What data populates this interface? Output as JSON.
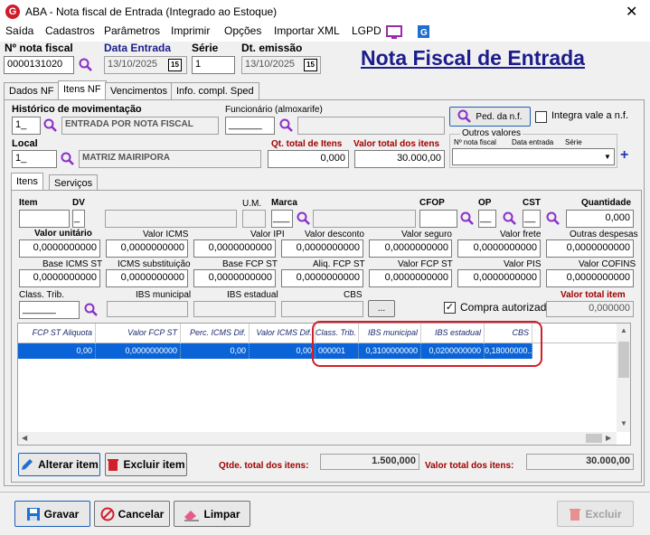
{
  "window": {
    "title": "ABA - Nota fiscal de Entrada (Integrado ao Estoque)",
    "app_icon": "G",
    "close": "✕"
  },
  "menu": [
    "Saída",
    "Cadastros",
    "Parâmetros",
    "Imprimir",
    "Opções",
    "Importar XML",
    "LGPD"
  ],
  "header": {
    "nota_label": "Nº nota fiscal",
    "nota_value": "0000131020",
    "data_entrada_label": "Data Entrada",
    "data_entrada_value": "13/10/2025",
    "serie_label": "Série",
    "serie_value": "1",
    "dt_emissao_label": "Dt. emissão",
    "dt_emissao_value": "13/10/2025",
    "cal_icon": "15",
    "big_title": "Nota Fiscal de Entrada"
  },
  "tabs": [
    "Dados NF",
    "Itens NF",
    "Vencimentos",
    "Info. compl. Sped"
  ],
  "itens_nf": {
    "historico_label": "Histórico de movimentação",
    "historico_code": "1_",
    "historico_desc": "ENTRADA POR NOTA FISCAL",
    "funcionario_label": "Funcionário (almoxarife)",
    "funcionario_value": "______",
    "ped_button": "Ped. da n.f.",
    "integra_label": "Integra vale a n.f.",
    "local_label": "Local",
    "local_code": "1_",
    "local_desc": "MATRIZ MAIRIPORA",
    "qt_total_label": "Qt. total de Itens",
    "qt_total_value": "0,000",
    "valor_total_label": "Valor total dos itens",
    "valor_total_value": "30.000,00",
    "outros_title": "Outros valores",
    "outros_col1": "Nº nota fiscal",
    "outros_col2": "Data entrada",
    "outros_col3": "Série",
    "plus": "+"
  },
  "subtabs": [
    "Itens",
    "Serviços"
  ],
  "item_form": {
    "item_label": "Item",
    "dv_label": "DV",
    "dv_value": "_",
    "um_label": "U.M.",
    "marca_label": "Marca",
    "marca_value": "___",
    "cfop_label": "CFOP",
    "op_label": "OP",
    "op_value": "__",
    "cst_label": "CST",
    "cst_value": "__",
    "quantidade_label": "Quantidade",
    "quantidade_value": "0,000",
    "row2_labels": [
      "Valor unitário",
      "Valor ICMS",
      "Valor IPI",
      "Valor desconto",
      "Valor seguro",
      "Valor frete",
      "Outras despesas"
    ],
    "row2_values": [
      "0,0000000000",
      "0,0000000000",
      "0,0000000000",
      "0,0000000000",
      "0,0000000000",
      "0,0000000000",
      "0,0000000000"
    ],
    "row3_labels": [
      "Base ICMS ST",
      "ICMS substituição",
      "Base FCP ST",
      "Aliq. FCP ST",
      "Valor FCP ST",
      "Valor PIS",
      "Valor COFINS"
    ],
    "row3_values": [
      "0,0000000000",
      "0,0000000000",
      "0,0000000000",
      "0,0000000000",
      "0,0000000000",
      "0,0000000000",
      "0,0000000000"
    ],
    "class_trib_label": "Class. Trib.",
    "class_trib_value": "______",
    "ibs_mun_label": "IBS municipal",
    "ibs_est_label": "IBS estadual",
    "cbs_label": "CBS",
    "ellipsis": "...",
    "compra_label": "Compra autorizada",
    "valor_total_item_label": "Valor total item",
    "valor_total_item_value": "0,000000"
  },
  "grid": {
    "headers": [
      "FCP ST Aliquota",
      "Valor FCP ST",
      "Perc. ICMS Dif.",
      "Valor ICMS Dif.",
      "Class. Trib.",
      "IBS municipal",
      "IBS estadual",
      "CBS"
    ],
    "row": [
      "0,00",
      "0,0000000000",
      "0,00",
      "0,00",
      "000001",
      "0,3100000000",
      "0,0200000000",
      "0,18000000..."
    ]
  },
  "footer": {
    "alterar": "Alterar item",
    "excluir_item": "Excluir item",
    "qtde_label": "Qtde. total dos itens:",
    "qtde_value": "1.500,000",
    "valor_label": "Valor total dos itens:",
    "valor_value": "30.000,00",
    "gravar": "Gravar",
    "cancelar": "Cancelar",
    "limpar": "Limpar",
    "excluir": "Excluir"
  },
  "colors": {
    "accent_blue": "#0a64d8",
    "title_blue": "#1c1c8c",
    "label_red": "#a00000",
    "highlight_red": "#d0202a"
  }
}
